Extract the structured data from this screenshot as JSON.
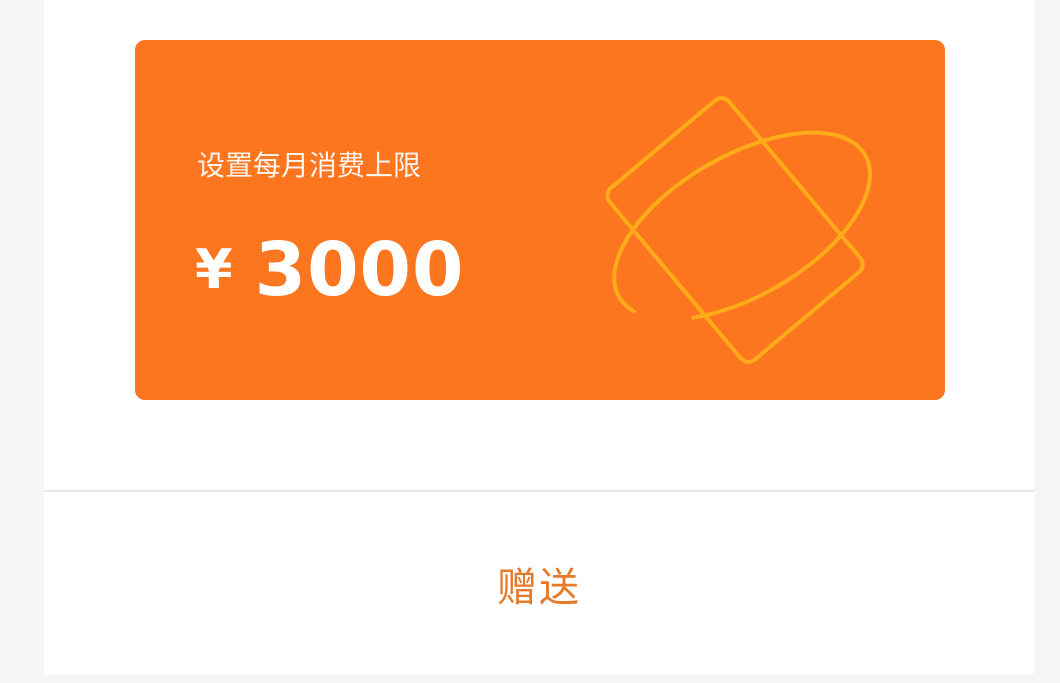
{
  "card": {
    "label": "设置每月消费上限",
    "currency_symbol": "¥",
    "amount": "3000",
    "background_color": "#fc761f",
    "decoration_icon": "card-orbit-icon"
  },
  "footer": {
    "gift_label": "赠送",
    "gift_color": "#e47a2a"
  }
}
